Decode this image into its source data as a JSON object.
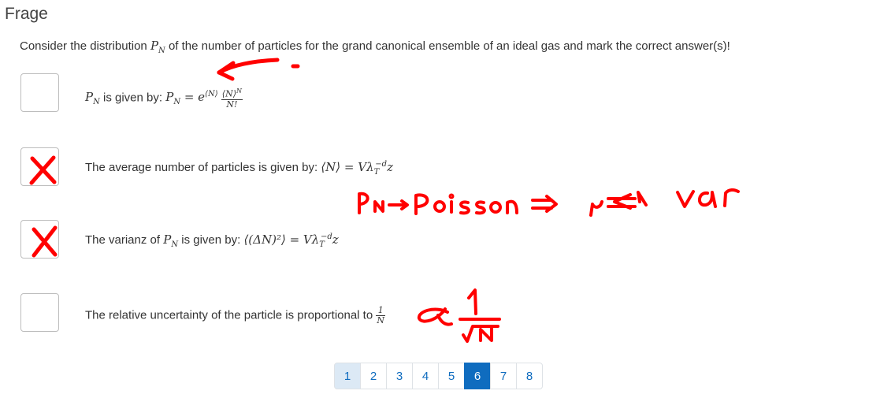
{
  "title": "Frage",
  "question": {
    "pre": "Consider the distribution ",
    "var": "P",
    "sub": "N",
    "post": " of the number of particles for the grand canonical ensemble of an ideal gas and mark the correct answer(s)!"
  },
  "options": [
    {
      "text": " is given by: ",
      "checked": false
    },
    {
      "text": "The average number of particles is given by: ",
      "checked": true
    },
    {
      "text": "The varianz of ",
      "checked": true
    },
    {
      "text": "The relative uncertainty of the particle is proportional to ",
      "checked": false
    }
  ],
  "option3_mid": " is given by: ",
  "pagination": {
    "pages": [
      "1",
      "2",
      "3",
      "4",
      "5",
      "6",
      "7",
      "8"
    ],
    "current": "6"
  },
  "annotation_colors": {
    "ink": "#ff0000"
  }
}
